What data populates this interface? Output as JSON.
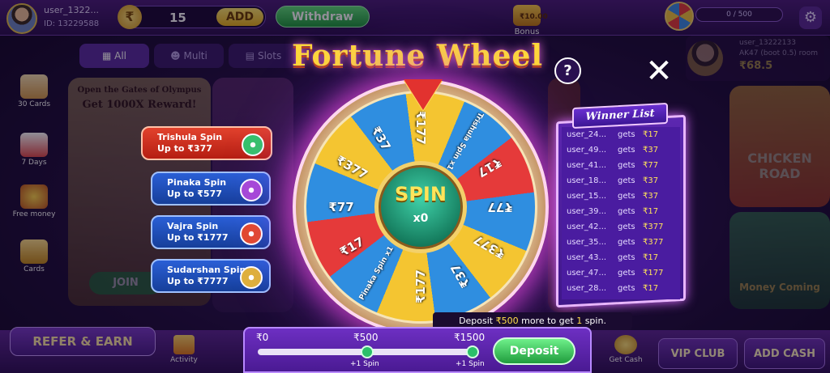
{
  "header": {
    "username": "user_1322...",
    "user_id": "ID: 13229588",
    "currency_symbol": "₹",
    "balance": "15",
    "add_label": "ADD",
    "withdraw_label": "Withdraw",
    "bonus_amount": "₹10.00",
    "bonus_label": "Bonus",
    "vip_progress": "0 / 500",
    "vip_wheel_icon": "prize-wheel-icon",
    "settings_icon": "gear-icon"
  },
  "categories": {
    "all": "All",
    "multi": "Multi",
    "slots": "Slots"
  },
  "sidebar": {
    "items": [
      {
        "label": "30 Cards"
      },
      {
        "label": "7 Days"
      },
      {
        "label": "Free money"
      },
      {
        "label": "Cards"
      }
    ]
  },
  "background": {
    "promo_line1": "Open the Gates of Olympus",
    "promo_line2": "Get 1000X Reward!",
    "join_label": "JOIN",
    "bigwin_user": "user_13222133",
    "bigwin_detail": "AK47 (boot 0.5) room",
    "bigwin_amount": "₹68.5",
    "chicken_road": "CHICKEN ROAD",
    "money_coming": "Money Coming"
  },
  "modal": {
    "title": "Fortune Wheel",
    "help_label": "?",
    "close_label": "✕",
    "spin_label": "SPIN",
    "spin_count": "x0",
    "segments": [
      {
        "label": "₹177",
        "color": "#f4c531"
      },
      {
        "label": "Trishula Spin x1",
        "color": "#2f8ee0"
      },
      {
        "label": "₹17",
        "color": "#e53a3a"
      },
      {
        "label": "₹77",
        "color": "#2f8ee0"
      },
      {
        "label": "₹377",
        "color": "#f4c531"
      },
      {
        "label": "₹37",
        "color": "#2f8ee0"
      },
      {
        "label": "₹177",
        "color": "#f4c531"
      },
      {
        "label": "Pinaka Spin x1",
        "color": "#2f8ee0"
      },
      {
        "label": "₹17",
        "color": "#e53a3a"
      },
      {
        "label": "₹77",
        "color": "#2f8ee0"
      },
      {
        "label": "₹377",
        "color": "#f4c531"
      },
      {
        "label": "₹37",
        "color": "#2f8ee0"
      }
    ],
    "spin_types": [
      {
        "name": "Trishula Spin",
        "limit": "Up to ₹377",
        "color": "#e2422d",
        "icon": "clover-icon"
      },
      {
        "name": "Pinaka Spin",
        "limit": "Up to ₹577",
        "color": "#2a5fd6",
        "icon": "clover-icon"
      },
      {
        "name": "Vajra Spin",
        "limit": "Up to ₹1777",
        "color": "#2a5fd6",
        "icon": "clover-icon"
      },
      {
        "name": "Sudarshan Spin",
        "limit": "Up to ₹7777",
        "color": "#2a5fd6",
        "icon": "lock-icon"
      }
    ],
    "winner_list": {
      "title": "Winner List",
      "rows": [
        {
          "user": "user_24...",
          "gets": "gets",
          "amount": "₹17"
        },
        {
          "user": "user_49...",
          "gets": "gets",
          "amount": "₹37"
        },
        {
          "user": "user_41...",
          "gets": "gets",
          "amount": "₹77"
        },
        {
          "user": "user_18...",
          "gets": "gets",
          "amount": "₹37"
        },
        {
          "user": "user_15...",
          "gets": "gets",
          "amount": "₹37"
        },
        {
          "user": "user_39...",
          "gets": "gets",
          "amount": "₹17"
        },
        {
          "user": "user_42...",
          "gets": "gets",
          "amount": "₹377"
        },
        {
          "user": "user_35...",
          "gets": "gets",
          "amount": "₹377"
        },
        {
          "user": "user_43...",
          "gets": "gets",
          "amount": "₹17"
        },
        {
          "user": "user_47...",
          "gets": "gets",
          "amount": "₹177"
        },
        {
          "user": "user_28...",
          "gets": "gets",
          "amount": "₹17"
        }
      ]
    },
    "deposit": {
      "tip_prefix": "Deposit ",
      "tip_amount": "₹500",
      "tip_middle": " more to get ",
      "tip_count": "1",
      "tip_suffix": " spin.",
      "progress_fraction": 0.0,
      "tick_0": "₹0",
      "tick_1": "₹500",
      "tick_2": "₹1500",
      "reward_1": "+1 Spin",
      "reward_2": "+1 Spin",
      "button_label": "Deposit"
    }
  },
  "footer": {
    "refer_label": "REFER & EARN",
    "activity_label": "Activity",
    "get_cash_label": "Get Cash",
    "vip_club_label": "VIP CLUB",
    "add_cash_label": "ADD CASH"
  }
}
